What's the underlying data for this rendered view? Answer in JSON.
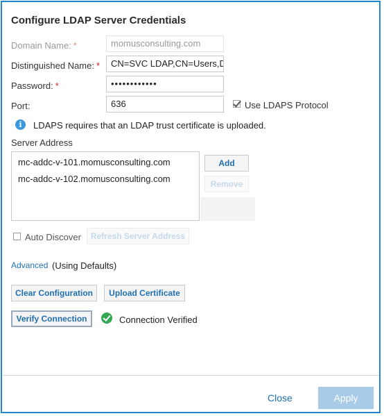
{
  "dialog": {
    "title": "Configure LDAP Server Credentials"
  },
  "fields": {
    "domain_name": {
      "label": "Domain Name:",
      "required_mark": "*",
      "value": "momusconsulting.com"
    },
    "distinguished_name": {
      "label": "Distinguished Name:",
      "required_mark": "*",
      "value": "CN=SVC LDAP,CN=Users,DC"
    },
    "password": {
      "label": "Password:",
      "required_mark": "*",
      "value": "••••••••••••"
    },
    "port": {
      "label": "Port:",
      "value": "636"
    }
  },
  "ldaps": {
    "checkbox_label": "Use LDAPS Protocol",
    "checked": true,
    "info_text": "LDAPS requires that an LDAP trust certificate is uploaded."
  },
  "server_address": {
    "label": "Server Address",
    "items": [
      "mc-addc-v-101.momusconsulting.com",
      "mc-addc-v-102.momusconsulting.com"
    ],
    "add_label": "Add",
    "remove_label": "Remove"
  },
  "auto_discover": {
    "label": "Auto Discover",
    "checked": false,
    "refresh_label": "Refresh Server Address"
  },
  "advanced": {
    "link_label": "Advanced",
    "note": "(Using Defaults)"
  },
  "actions": {
    "clear_label": "Clear Configuration",
    "upload_label": "Upload Certificate",
    "verify_label": "Verify Connection",
    "status_text": "Connection Verified"
  },
  "footer": {
    "close_label": "Close",
    "apply_label": "Apply"
  },
  "colors": {
    "accent": "#1e88d4",
    "link": "#1f6fb2",
    "required": "#d9232d",
    "success": "#34a853",
    "apply_disabled": "#a8cbe8"
  }
}
